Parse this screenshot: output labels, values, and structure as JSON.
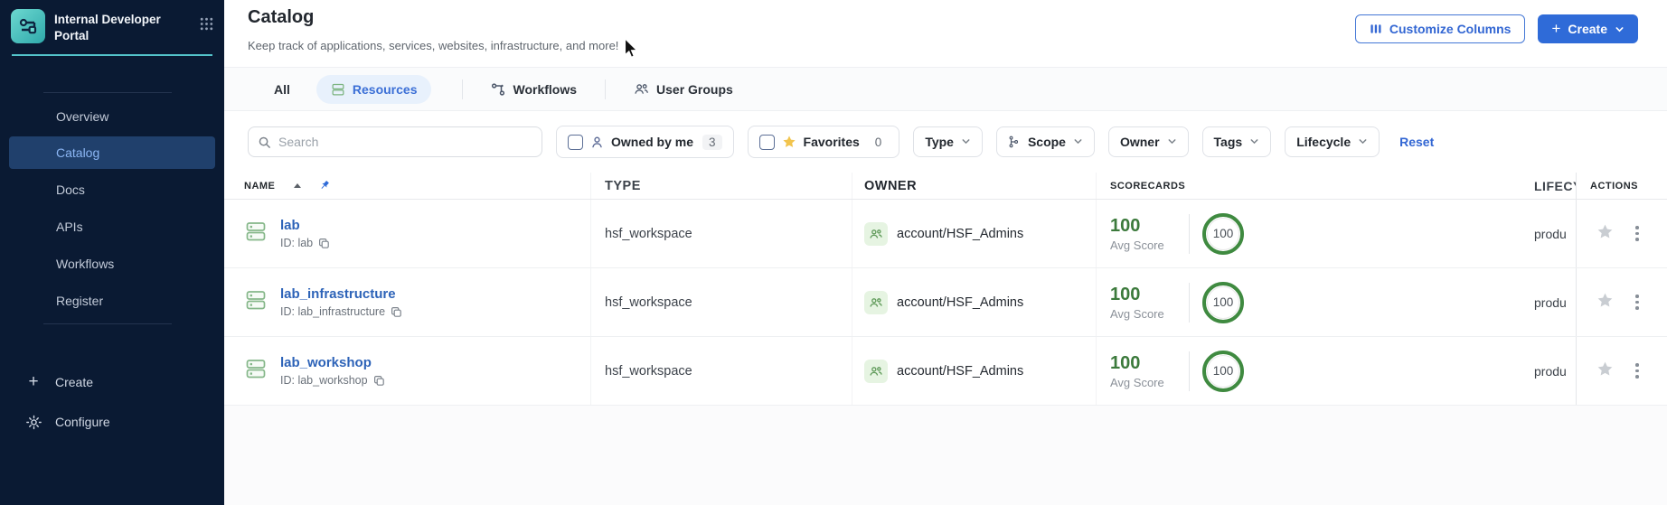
{
  "app": {
    "title": "Internal Developer Portal"
  },
  "sidebar": {
    "nav": [
      {
        "label": "Overview"
      },
      {
        "label": "Catalog"
      },
      {
        "label": "Docs"
      },
      {
        "label": "APIs"
      },
      {
        "label": "Workflows"
      },
      {
        "label": "Register"
      }
    ],
    "footer": [
      {
        "label": "Create"
      },
      {
        "label": "Configure"
      }
    ]
  },
  "header": {
    "title": "Catalog",
    "subtitle": "Keep track of applications, services, websites, infrastructure, and more!",
    "customize_columns_label": "Customize Columns",
    "create_label": "Create"
  },
  "tabs": [
    {
      "label": "All"
    },
    {
      "label": "Resources"
    },
    {
      "label": "Workflows"
    },
    {
      "label": "User Groups"
    }
  ],
  "filters": {
    "search_placeholder": "Search",
    "owned_by_me": {
      "label": "Owned by me",
      "count": "3"
    },
    "favorites": {
      "label": "Favorites",
      "count": "0"
    },
    "dropdowns": [
      {
        "label": "Type"
      },
      {
        "label": "Scope"
      },
      {
        "label": "Owner"
      },
      {
        "label": "Tags"
      },
      {
        "label": "Lifecycle"
      }
    ],
    "reset_label": "Reset"
  },
  "table": {
    "columns": {
      "name": "NAME",
      "type": "TYPE",
      "owner": "OWNER",
      "scorecards": "SCORECARDS",
      "lifecycle": "LIFECY",
      "actions": "ACTIONS"
    },
    "avg_score_label": "Avg Score",
    "rows": [
      {
        "name": "lab",
        "id": "ID: lab",
        "type": "hsf_workspace",
        "owner": "account/HSF_Admins",
        "avg_score": "100",
        "score": "100",
        "lifecycle": "produ"
      },
      {
        "name": "lab_infrastructure",
        "id": "ID: lab_infrastructure",
        "type": "hsf_workspace",
        "owner": "account/HSF_Admins",
        "avg_score": "100",
        "score": "100",
        "lifecycle": "produ"
      },
      {
        "name": "lab_workshop",
        "id": "ID: lab_workshop",
        "type": "hsf_workspace",
        "owner": "account/HSF_Admins",
        "avg_score": "100",
        "score": "100",
        "lifecycle": "produ"
      }
    ]
  },
  "colors": {
    "sidebar_bg": "#0a1a33",
    "sidebar_active_bg": "#20406c",
    "sidebar_active_text": "#8cb6f4",
    "accent_teal": "#54c4cb",
    "accent_blue": "#2f6bd8",
    "link_blue": "#2d63b8",
    "score_green": "#3f8a40",
    "resource_green": "#85b789",
    "favorite_yellow": "#f2c44d"
  }
}
